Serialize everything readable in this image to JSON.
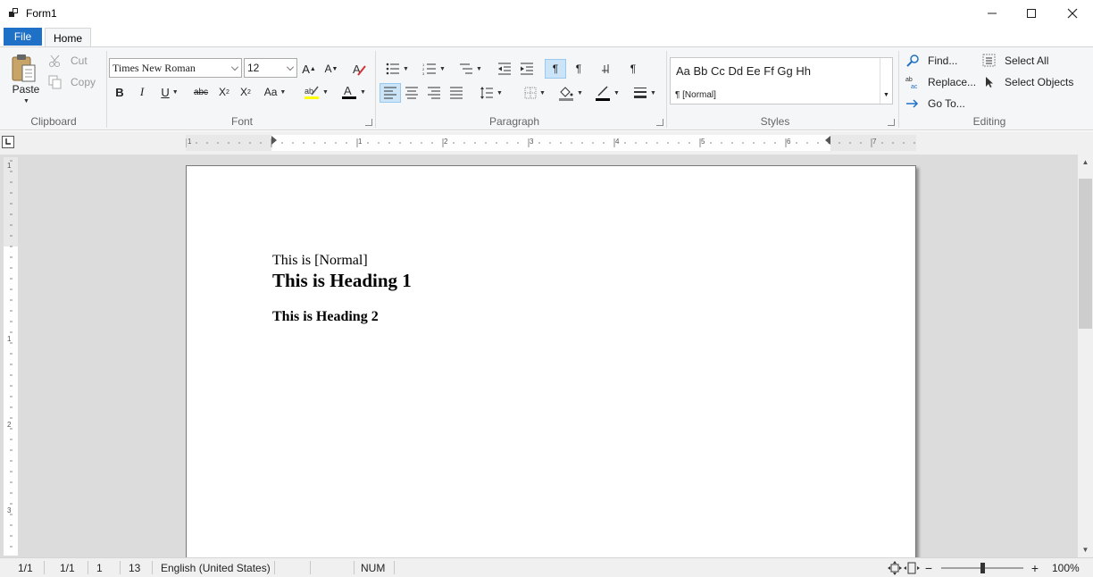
{
  "window": {
    "title": "Form1",
    "minimize_label": "Minimize",
    "maximize_label": "Maximize",
    "close_label": "Close"
  },
  "tabs": [
    {
      "label": "File",
      "active": false
    },
    {
      "label": "Home",
      "active": true
    }
  ],
  "ribbon": {
    "clipboard": {
      "label": "Clipboard",
      "paste": "Paste",
      "cut": "Cut",
      "copy": "Copy"
    },
    "font": {
      "label": "Font",
      "family": "Times New Roman",
      "size": "12",
      "change_case": "Aa"
    },
    "paragraph": {
      "label": "Paragraph"
    },
    "styles": {
      "label": "Styles",
      "sample": "Aa Bb Cc Dd Ee Ff Gg Hh",
      "current": "¶ [Normal]"
    },
    "editing": {
      "label": "Editing",
      "find": "Find...",
      "replace": "Replace...",
      "goto": "Go To...",
      "select_all": "Select All",
      "select_objects": "Select Objects"
    }
  },
  "ruler": {
    "numbers": [
      "1",
      "1",
      "2",
      "3",
      "4",
      "5",
      "6",
      "7"
    ],
    "vnumbers": [
      "1",
      "1",
      "2",
      "3"
    ]
  },
  "document": {
    "lines": [
      {
        "text": "This is [Normal]",
        "style": "Normal"
      },
      {
        "text": "This is Heading 1",
        "style": "Heading 1"
      },
      {
        "text": "This is Heading 2",
        "style": "Heading 2"
      }
    ]
  },
  "statusbar": {
    "page": "1/1",
    "section": "1/1",
    "line": "1",
    "column": "13",
    "language": "English (United States)",
    "num": "NUM",
    "zoom": "100%",
    "zoom_level": 0.5
  },
  "colors": {
    "accent": "#1f71c7",
    "ribbon_bg": "#f5f6f7",
    "canvas_bg": "#dcdcdc",
    "selected_bg": "#cce4f7"
  }
}
